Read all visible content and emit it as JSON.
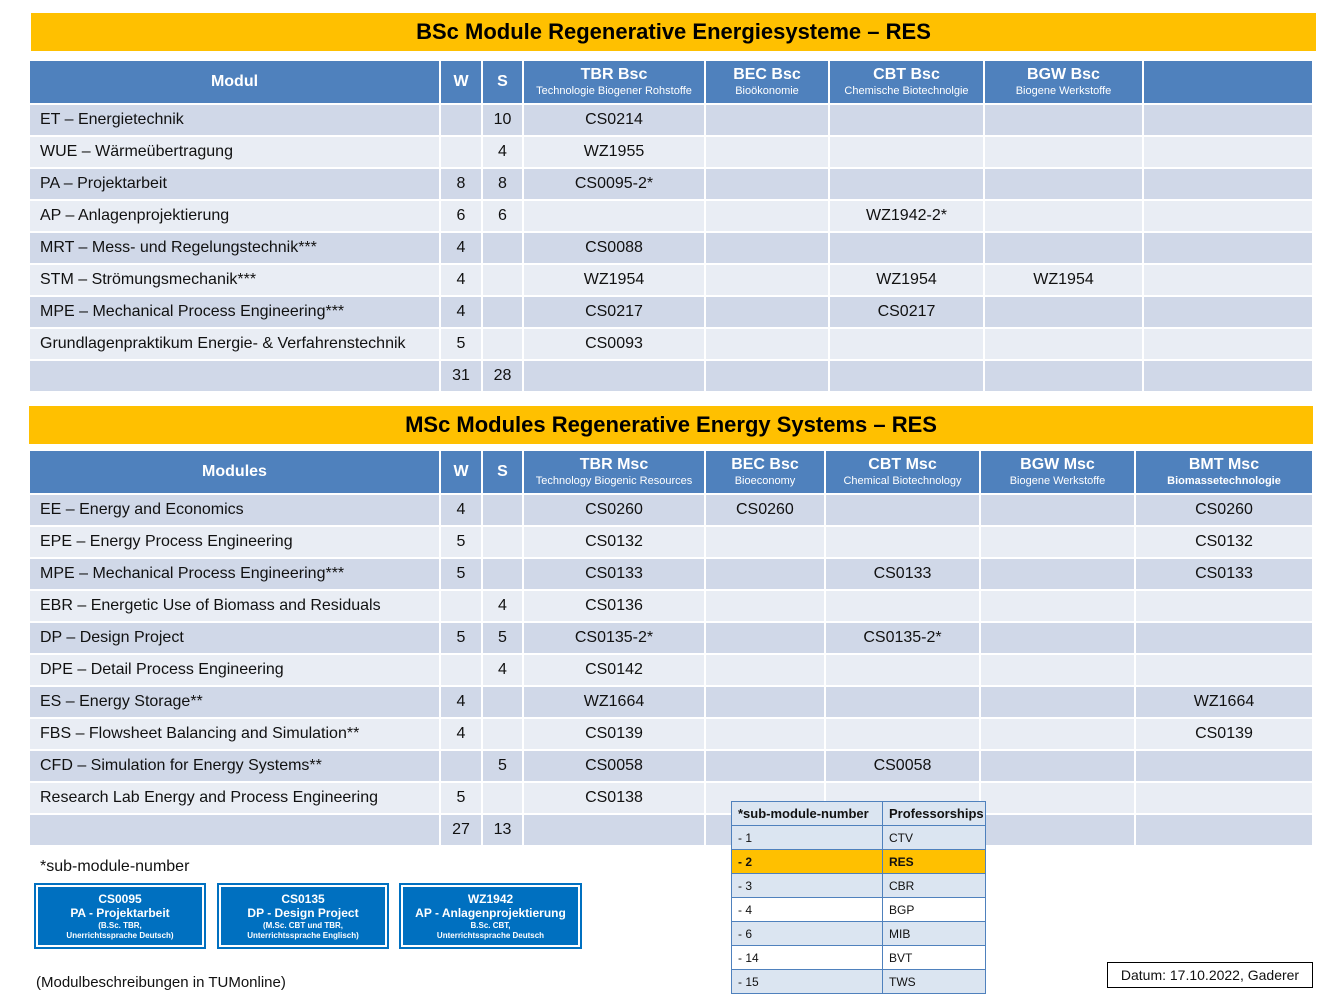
{
  "bsc": {
    "title": "BSc Module Regenerative Energiesysteme – RES",
    "headers": {
      "modul": "Modul",
      "w": "W",
      "s": "S",
      "c1_main": "TBR Bsc",
      "c1_sub": "Technologie Biogener Rohstoffe",
      "c2_main": "BEC Bsc",
      "c2_sub": "Bioökonomie",
      "c3_main": "CBT Bsc",
      "c3_sub": "Chemische Biotechnolgie",
      "c4_main": "BGW Bsc",
      "c4_sub": "Biogene Werkstoffe",
      "c5_main": ""
    },
    "rows": [
      {
        "name": "ET – Energietechnik",
        "w": "",
        "s": "10",
        "tbr": "CS0214",
        "bec": "",
        "cbt": "",
        "bgw": "",
        "extra": ""
      },
      {
        "name": "WUE – Wärmeübertragung",
        "w": "",
        "s": "4",
        "tbr": "WZ1955",
        "bec": "",
        "cbt": "",
        "bgw": "",
        "extra": ""
      },
      {
        "name": "PA – Projektarbeit",
        "w": "8",
        "s": "8",
        "tbr": "CS0095-2*",
        "bec": "",
        "cbt": "",
        "bgw": "",
        "extra": ""
      },
      {
        "name": "AP – Anlagenprojektierung",
        "w": "6",
        "s": "6",
        "tbr": "",
        "bec": "",
        "cbt": "WZ1942-2*",
        "bgw": "",
        "extra": ""
      },
      {
        "name": "MRT – Mess- und Regelungstechnik***",
        "w": "4",
        "s": "",
        "tbr": "CS0088",
        "bec": "",
        "cbt": "",
        "bgw": "",
        "extra": ""
      },
      {
        "name": "STM – Strömungsmechanik***",
        "w": "4",
        "s": "",
        "tbr": "WZ1954",
        "bec": "",
        "cbt": "WZ1954",
        "bgw": "WZ1954",
        "extra": ""
      },
      {
        "name": "MPE – Mechanical Process Engineering***",
        "w": "4",
        "s": "",
        "tbr": "CS0217",
        "bec": "",
        "cbt": "CS0217",
        "bgw": "",
        "extra": ""
      },
      {
        "name": "Grundlagenpraktikum Energie- & Verfahrenstechnik",
        "w": "5",
        "s": "",
        "tbr": "CS0093",
        "bec": "",
        "cbt": "",
        "bgw": "",
        "extra": ""
      },
      {
        "name": "",
        "w": "31",
        "s": "28",
        "tbr": "",
        "bec": "",
        "cbt": "",
        "bgw": "",
        "extra": ""
      }
    ]
  },
  "msc": {
    "title": "MSc Modules Regenerative Energy Systems – RES",
    "headers": {
      "modul": "Modules",
      "w": "W",
      "s": "S",
      "c1_main": "TBR Msc",
      "c1_sub": "Technology Biogenic Resources",
      "c2_main": "BEC Bsc",
      "c2_sub": "Bioeconomy",
      "c3_main": "CBT Msc",
      "c3_sub": "Chemical Biotechnology",
      "c4_main": "BGW Msc",
      "c4_sub": "Biogene Werkstoffe",
      "c5_main": "BMT Msc",
      "c5_sub": "Biomassetechnologie"
    },
    "rows": [
      {
        "name": "EE – Energy and Economics",
        "w": "4",
        "s": "",
        "tbr": "CS0260",
        "bec": "CS0260",
        "cbt": "",
        "bgw": "",
        "bmt": "CS0260"
      },
      {
        "name": "EPE – Energy Process Engineering",
        "w": "5",
        "s": "",
        "tbr": "CS0132",
        "bec": "",
        "cbt": "",
        "bgw": "",
        "bmt": "CS0132"
      },
      {
        "name": "MPE – Mechanical Process Engineering***",
        "w": "5",
        "s": "",
        "tbr": "CS0133",
        "bec": "",
        "cbt": "CS0133",
        "bgw": "",
        "bmt": "CS0133"
      },
      {
        "name": "EBR – Energetic Use of Biomass and Residuals",
        "w": "",
        "s": "4",
        "tbr": "CS0136",
        "bec": "",
        "cbt": "",
        "bgw": "",
        "bmt": ""
      },
      {
        "name": "DP – Design Project",
        "w": "5",
        "s": "5",
        "tbr": "CS0135-2*",
        "bec": "",
        "cbt": "CS0135-2*",
        "bgw": "",
        "bmt": ""
      },
      {
        "name": "DPE – Detail Process Engineering",
        "w": "",
        "s": "4",
        "tbr": "CS0142",
        "bec": "",
        "cbt": "",
        "bgw": "",
        "bmt": ""
      },
      {
        "name": "ES – Energy Storage**",
        "w": "4",
        "s": "",
        "tbr": "WZ1664",
        "bec": "",
        "cbt": "",
        "bgw": "",
        "bmt": "WZ1664"
      },
      {
        "name": "FBS – Flowsheet Balancing and Simulation**",
        "w": "4",
        "s": "",
        "tbr": "CS0139",
        "bec": "",
        "cbt": "",
        "bgw": "",
        "bmt": "CS0139"
      },
      {
        "name": "CFD – Simulation for Energy Systems**",
        "w": "",
        "s": "5",
        "tbr": "CS0058",
        "bec": "",
        "cbt": "CS0058",
        "bgw": "",
        "bmt": ""
      },
      {
        "name": "Research Lab  Energy and Process Engineering",
        "w": "5",
        "s": "",
        "tbr": "CS0138",
        "bec": "",
        "cbt": "",
        "bgw": "",
        "bmt": ""
      },
      {
        "name": "",
        "w": "27",
        "s": "13",
        "tbr": "",
        "bec": "",
        "cbt": "",
        "bgw": "",
        "bmt": ""
      }
    ]
  },
  "footnote": "*sub-module-number",
  "badges": [
    {
      "code": "CS0095",
      "title": "PA - Projektarbeit",
      "sub1": "(B.Sc. TBR,",
      "sub2": "Unerrichtssprache Deutsch)"
    },
    {
      "code": "CS0135",
      "title": "DP - Design Project",
      "sub1": "(M.Sc. CBT und TBR,",
      "sub2": "Unterrichtssprache Englisch)"
    },
    {
      "code": "WZ1942",
      "title": "AP - Anlagenprojektierung",
      "sub1": "B.Sc. CBT,",
      "sub2": "Unterrichtssprache Deutsch"
    }
  ],
  "modulbeschreibungen": "(Modulbeschreibungen  in TUMonline)",
  "legend": {
    "col1": "*sub-module-number",
    "col2": "Professorships",
    "rows": [
      {
        "num": "- 1",
        "prof": "CTV"
      },
      {
        "num": "- 2",
        "prof": "RES"
      },
      {
        "num": "- 3",
        "prof": "CBR"
      },
      {
        "num": "- 4",
        "prof": "BGP"
      },
      {
        "num": "- 6",
        "prof": "MIB"
      },
      {
        "num": "- 14",
        "prof": "BVT"
      },
      {
        "num": "- 15",
        "prof": "TWS"
      }
    ],
    "highlight_color": "#ffc000"
  },
  "datum": "Datum: 17.10.2022, Gaderer",
  "colors": {
    "header": "#4f81bd",
    "banner": "#ffc000",
    "badge": "#0070c0",
    "row_dark": "#d0d8e8",
    "row_light": "#e9edf4"
  }
}
